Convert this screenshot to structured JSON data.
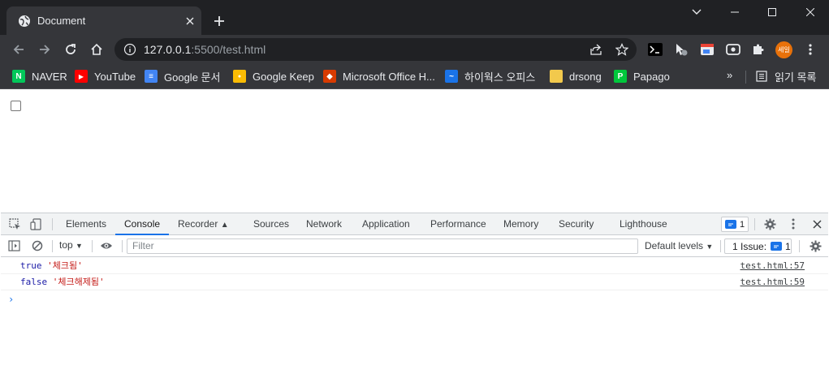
{
  "browser": {
    "tab": {
      "title": "Document",
      "favicon": "globe-icon",
      "close_icon": "close-icon"
    },
    "window_controls": [
      "chevron-down-icon",
      "minimize-icon",
      "maximize-icon",
      "close-icon"
    ],
    "address": {
      "host": "127.0.0.1",
      "rest": ":5500/test.html",
      "left_icon": "info-icon"
    },
    "bookmarks": [
      {
        "label": "NAVER",
        "icon": "naver-icon",
        "icon_text": "N",
        "color": "#03c75a"
      },
      {
        "label": "YouTube",
        "icon": "youtube-icon",
        "icon_text": "▶",
        "color": "#ff0000"
      },
      {
        "label": "Google 문서",
        "icon": "docs-icon",
        "icon_text": "≡",
        "color": "#4285f4"
      },
      {
        "label": "Google Keep",
        "icon": "keep-icon",
        "icon_text": "●",
        "color": "#fbbc04"
      },
      {
        "label": "Microsoft Office H...",
        "icon": "office-icon",
        "icon_text": "◆",
        "color": "#d83b01"
      },
      {
        "label": "하이웍스 오피스",
        "icon": "hiworks-icon",
        "icon_text": "~",
        "color": "#1a73e8"
      },
      {
        "label": "drsong",
        "icon": "folder-icon",
        "icon_text": "",
        "color": "#f2c94c"
      },
      {
        "label": "Papago",
        "icon": "papago-icon",
        "icon_text": "P",
        "color": "#00c73c"
      }
    ],
    "bookmarks_more": "»",
    "reading_list": "읽기 목록",
    "profile_text": "세일"
  },
  "page": {
    "checkbox_checked": false
  },
  "devtools": {
    "tabs": [
      "Elements",
      "Console",
      "Recorder",
      "Sources",
      "Network",
      "Application",
      "Performance",
      "Memory",
      "Security",
      "Lighthouse"
    ],
    "active_tab": "Console",
    "message_count": "1",
    "context": "top",
    "filter_placeholder": "Filter",
    "levels": "Default levels",
    "issues_label": "1 Issue:",
    "issues_count": "1",
    "logs": [
      {
        "bool": "true",
        "str": "'체크됨'",
        "source": "test.html:57"
      },
      {
        "bool": "false",
        "str": "'체크해제됨'",
        "source": "test.html:59"
      }
    ],
    "prompt": "›"
  }
}
